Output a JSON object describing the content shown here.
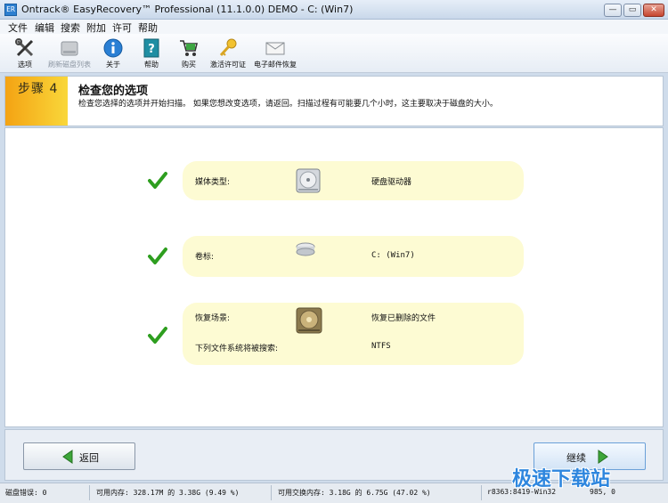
{
  "window": {
    "title": "Ontrack® EasyRecovery™ Professional (11.1.0.0) DEMO - C: (Win7)",
    "app_icon_text": "ER",
    "controls": {
      "min": "—",
      "max": "▭",
      "close": "✕"
    }
  },
  "menu": [
    "文件",
    "编辑",
    "搜索",
    "附加",
    "许可",
    "帮助"
  ],
  "toolbar": [
    {
      "label": "选项",
      "icon": "tools-icon",
      "enabled": true
    },
    {
      "label": "刷新磁盘列表",
      "icon": "refresh-disk-icon",
      "enabled": false
    },
    {
      "label": "关于",
      "icon": "info-icon",
      "enabled": true
    },
    {
      "label": "帮助",
      "icon": "help-book-icon",
      "enabled": true
    },
    {
      "label": "购买",
      "icon": "cart-icon",
      "enabled": true
    },
    {
      "label": "激活许可证",
      "icon": "key-icon",
      "enabled": true
    },
    {
      "label": "电子邮件恢复",
      "icon": "envelope-icon",
      "enabled": true
    }
  ],
  "banner": {
    "step": "步骤 4",
    "title": "检查您的选项",
    "description": "检查您选择的选项并开始扫描。 如果您想改变选项，请返回。扫描过程有可能要几个小时，这主要取决于磁盘的大小。"
  },
  "summary": {
    "media": {
      "label": "媒体类型:",
      "value": "硬盘驱动器"
    },
    "volume": {
      "label": "卷标:",
      "value": "C: (Win7)"
    },
    "scenario": {
      "label": "恢复场景:",
      "value": "恢复已删除的文件"
    },
    "filesystem": {
      "label": "下列文件系统将被搜索:",
      "value": "NTFS"
    }
  },
  "buttons": {
    "back": "返回",
    "next": "继续"
  },
  "status": {
    "disk_errors": "磁盘错误: 0",
    "memory": "可用内存: 328.17M 的 3.38G (9.49 %)",
    "swap": "可用交换内存: 3.18G 的 6.75G (47.02 %)",
    "build": "r8363:8419-Win32",
    "counts": "985, 0"
  },
  "watermark": "极速下载站",
  "colors": {
    "accent": "#2e86de",
    "step_tab": "#f4a313",
    "card": "#fdfbd3",
    "check": "#2e9e1f"
  }
}
